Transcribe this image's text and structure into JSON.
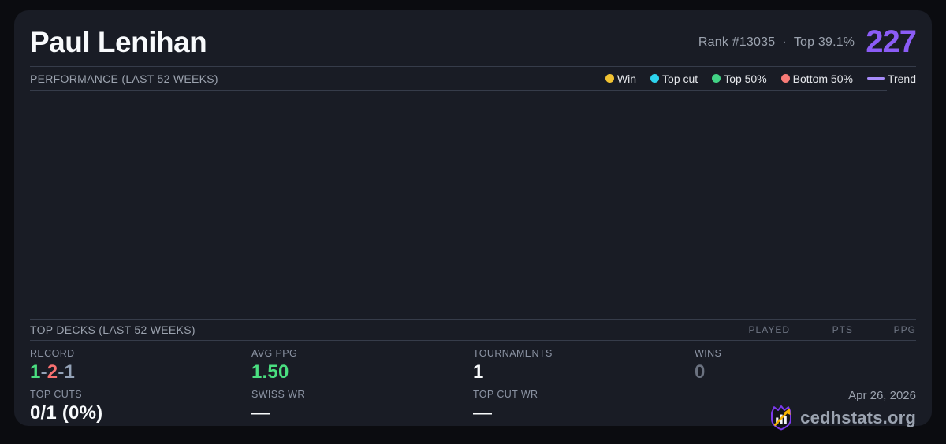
{
  "colors": {
    "accent_purple": "#8b5cf6",
    "trend_purple": "#a78bfa",
    "win_yellow": "#f1c232",
    "topcut_cyan": "#2dd4ef",
    "top50_green": "#42d385",
    "bottom50_red": "#f87b77",
    "value_green": "#4ade80",
    "value_red": "#f87171",
    "value_gray": "#94a3b8",
    "dim_gray": "#6b7280",
    "white": "#f8fafc"
  },
  "header": {
    "player_name": "Paul Lenihan",
    "rank_text": "Rank #13035",
    "separator": "·",
    "top_percent_text": "Top 39.1%",
    "points": "227"
  },
  "performance": {
    "title": "PERFORMANCE (LAST 52 WEEKS)",
    "legend": [
      {
        "label": "Win",
        "color": "#f1c232"
      },
      {
        "label": "Top cut",
        "color": "#2dd4ef"
      },
      {
        "label": "Top 50%",
        "color": "#42d385"
      },
      {
        "label": "Bottom 50%",
        "color": "#f87b77"
      }
    ],
    "trend_label": "Trend",
    "trend_color": "#a78bfa"
  },
  "chart_data": {
    "type": "scatter",
    "title": "PERFORMANCE (LAST 52 WEEKS)",
    "series": [
      {
        "name": "Win",
        "color": "#f1c232",
        "points": []
      },
      {
        "name": "Top cut",
        "color": "#2dd4ef",
        "points": []
      },
      {
        "name": "Top 50%",
        "color": "#42d385",
        "points": []
      },
      {
        "name": "Bottom 50%",
        "color": "#f87b77",
        "points": []
      },
      {
        "name": "Trend",
        "color": "#a78bfa",
        "points": []
      }
    ],
    "axes_visible": false,
    "grid": false,
    "legend_position": "top-right"
  },
  "top_decks": {
    "title": "TOP DECKS (LAST 52 WEEKS)",
    "columns": [
      "PLAYED",
      "PTS",
      "PPG"
    ],
    "rows": []
  },
  "stats": {
    "record": {
      "label": "RECORD",
      "wins": "1",
      "sep1": "-",
      "losses": "2",
      "sep2": "-",
      "draws": "1"
    },
    "avg_ppg": {
      "label": "AVG PPG",
      "value": "1.50"
    },
    "tournaments": {
      "label": "TOURNAMENTS",
      "value": "1"
    },
    "wins": {
      "label": "WINS",
      "value": "0"
    },
    "top_cuts": {
      "label": "TOP CUTS",
      "value": "0/1 (0%)"
    },
    "swiss_wr": {
      "label": "SWISS WR",
      "value": "—"
    },
    "top_cut_wr": {
      "label": "TOP CUT WR",
      "value": "—"
    }
  },
  "footer": {
    "date": "Apr 26, 2026",
    "brand": "cedhstats.org"
  }
}
